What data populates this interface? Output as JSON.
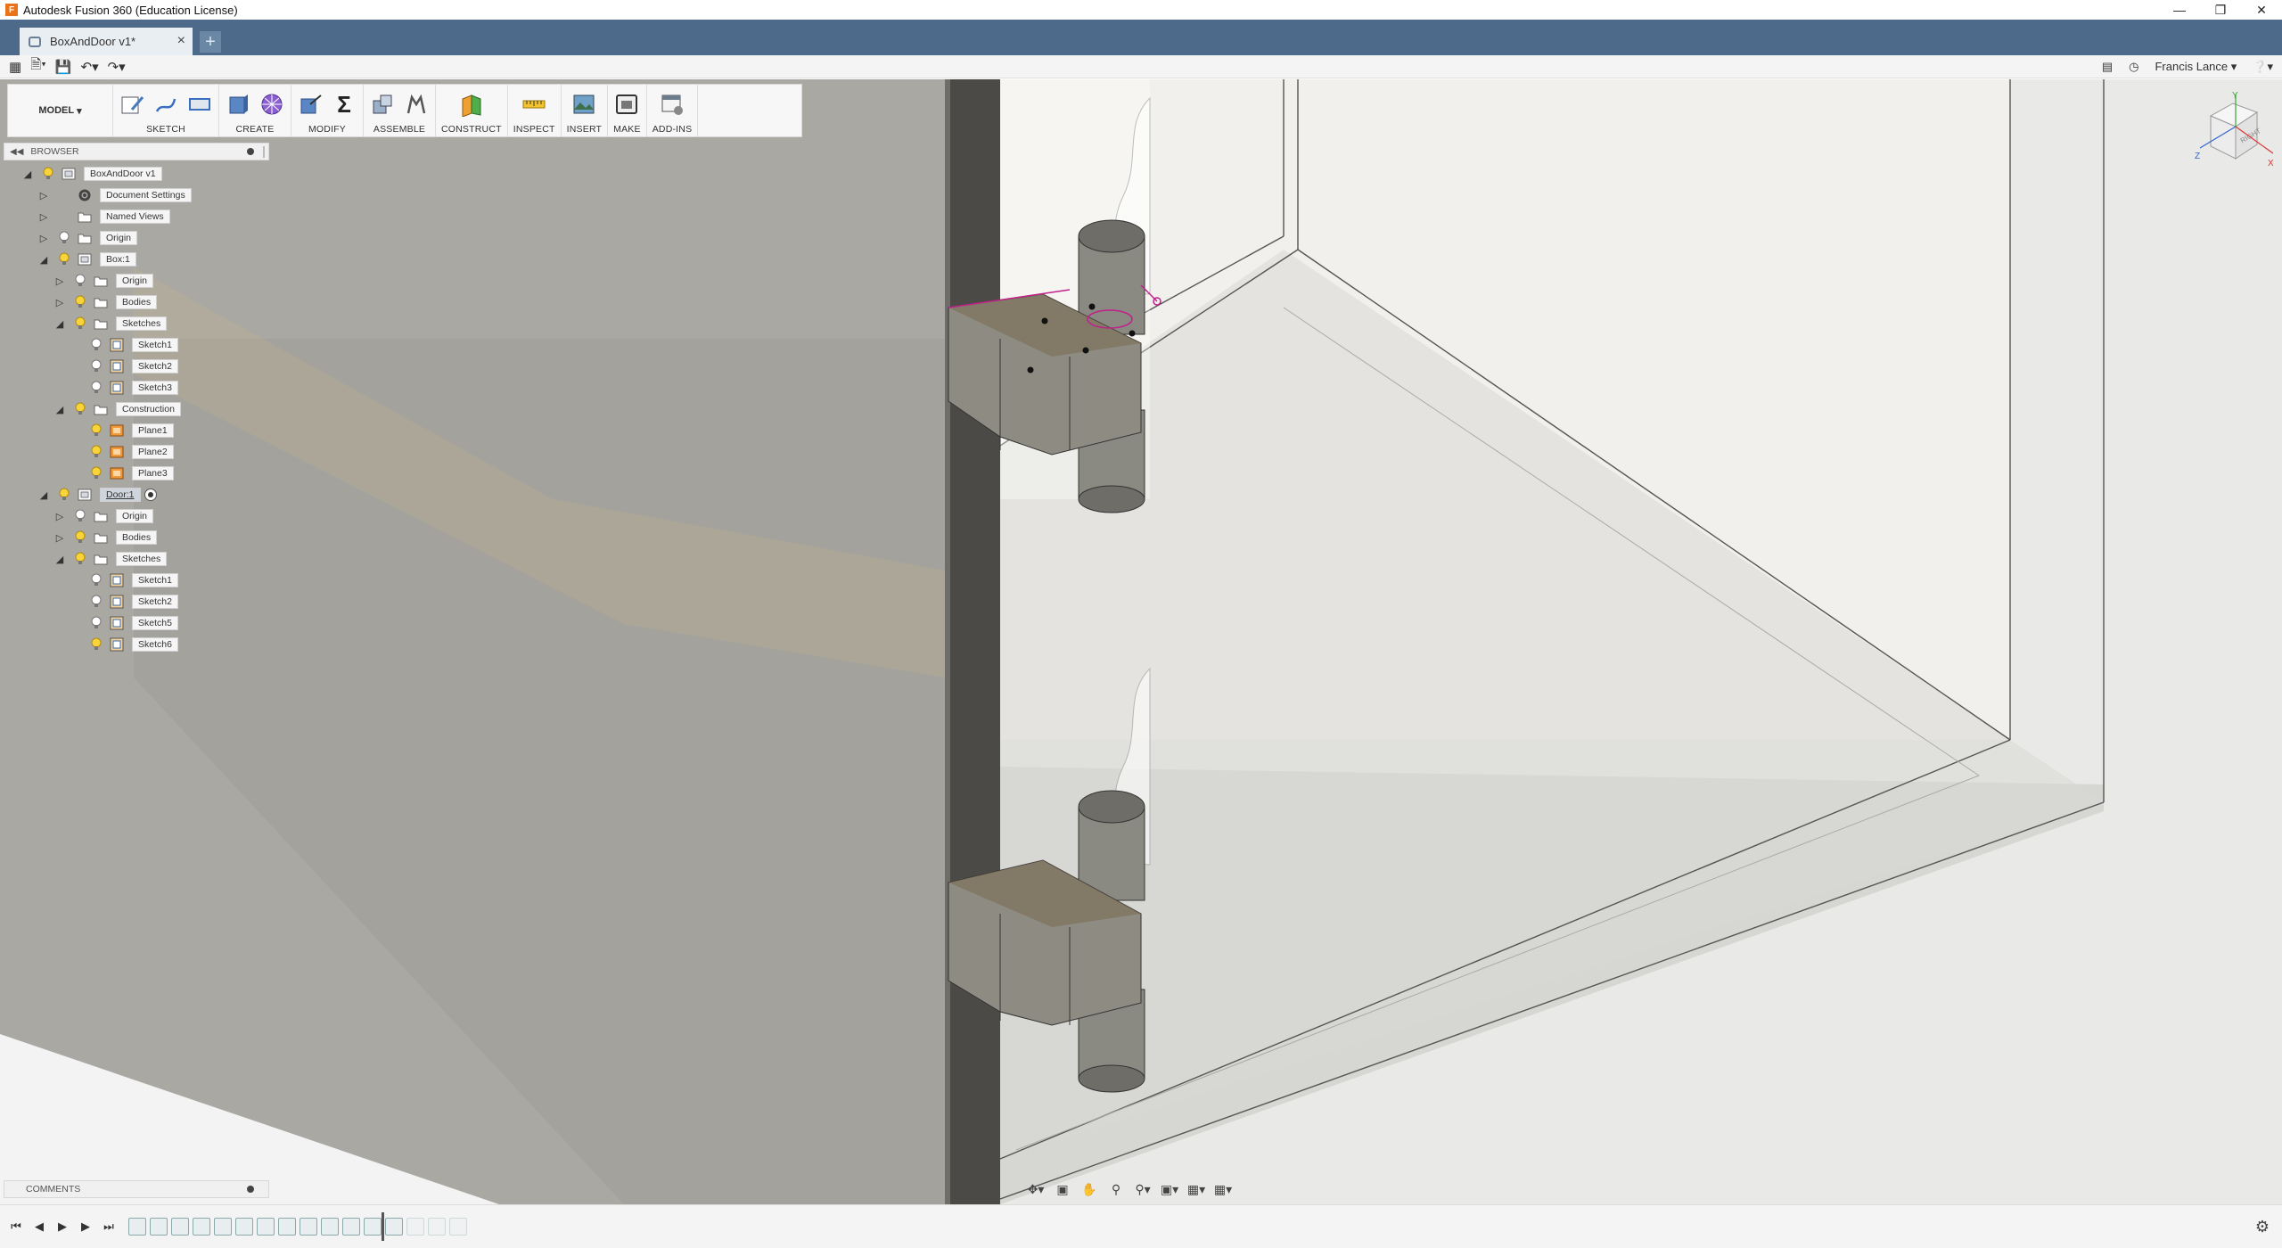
{
  "window": {
    "title": "Autodesk Fusion 360 (Education License)"
  },
  "tabs": {
    "document": "BoxAndDoor v1*"
  },
  "qat": {
    "user": "Francis Lance"
  },
  "toolbar": {
    "workspace": "MODEL",
    "groups": [
      "SKETCH",
      "CREATE",
      "MODIFY",
      "ASSEMBLE",
      "CONSTRUCT",
      "INSPECT",
      "INSERT",
      "MAKE",
      "ADD-INS"
    ]
  },
  "browser": {
    "title": "BROWSER",
    "items": [
      {
        "label": "BoxAndDoor v1",
        "level": 0,
        "expanded": true,
        "icon": "component"
      },
      {
        "label": "Document Settings",
        "level": 1,
        "expanded": false,
        "icon": "gear"
      },
      {
        "label": "Named Views",
        "level": 1,
        "expanded": false,
        "icon": "folder"
      },
      {
        "label": "Origin",
        "level": 1,
        "expanded": false,
        "icon": "folder"
      },
      {
        "label": "Box:1",
        "level": 1,
        "expanded": true,
        "icon": "component"
      },
      {
        "label": "Origin",
        "level": 2,
        "expanded": false,
        "icon": "folder"
      },
      {
        "label": "Bodies",
        "level": 2,
        "expanded": false,
        "icon": "folder"
      },
      {
        "label": "Sketches",
        "level": 2,
        "expanded": true,
        "icon": "folder"
      },
      {
        "label": "Sketch1",
        "level": 3,
        "icon": "sketch"
      },
      {
        "label": "Sketch2",
        "level": 3,
        "icon": "sketch"
      },
      {
        "label": "Sketch3",
        "level": 3,
        "icon": "sketch"
      },
      {
        "label": "Construction",
        "level": 2,
        "expanded": true,
        "icon": "folder"
      },
      {
        "label": "Plane1",
        "level": 3,
        "icon": "plane"
      },
      {
        "label": "Plane2",
        "level": 3,
        "icon": "plane"
      },
      {
        "label": "Plane3",
        "level": 3,
        "icon": "plane"
      },
      {
        "label": "Door:1",
        "level": 1,
        "expanded": true,
        "icon": "component",
        "active": true
      },
      {
        "label": "Origin",
        "level": 2,
        "expanded": false,
        "icon": "folder"
      },
      {
        "label": "Bodies",
        "level": 2,
        "expanded": false,
        "icon": "folder"
      },
      {
        "label": "Sketches",
        "level": 2,
        "expanded": true,
        "icon": "folder"
      },
      {
        "label": "Sketch1",
        "level": 3,
        "icon": "sketch"
      },
      {
        "label": "Sketch2",
        "level": 3,
        "icon": "sketch"
      },
      {
        "label": "Sketch5",
        "level": 3,
        "icon": "sketch"
      },
      {
        "label": "Sketch6",
        "level": 3,
        "icon": "sketch"
      }
    ]
  },
  "comments": {
    "title": "COMMENTS"
  },
  "viewcube": {
    "face": "RIGHT",
    "axes": [
      "X",
      "Y",
      "Z"
    ]
  },
  "colors": {
    "tabbar": "#4d6a8a",
    "plane": "#e8c98a",
    "sketch_line": "#c0208a"
  }
}
